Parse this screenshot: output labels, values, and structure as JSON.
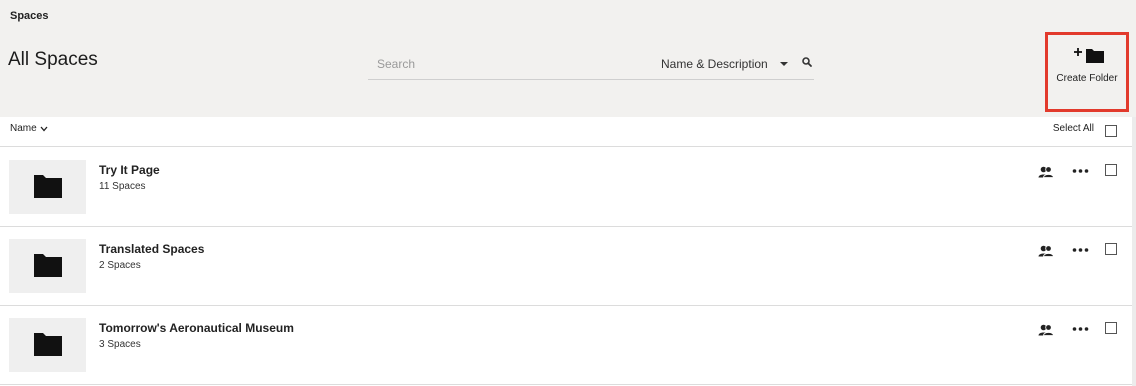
{
  "breadcrumb": "Spaces",
  "page_title": "All Spaces",
  "search": {
    "placeholder": "Search",
    "value": "",
    "scope": "Name & Description"
  },
  "create_folder": {
    "label": "Create Folder",
    "icon": "add-folder-icon"
  },
  "list_header": {
    "sort_label": "Name",
    "select_all_label": "Select All"
  },
  "rows": [
    {
      "title": "Try It Page",
      "subtitle": "11 Spaces"
    },
    {
      "title": "Translated Spaces",
      "subtitle": "2 Spaces"
    },
    {
      "title": "Tomorrow's Aeronautical Museum",
      "subtitle": "3 Spaces"
    }
  ],
  "colors": {
    "header_bg": "#f2f1ef",
    "highlight": "#e23a2c"
  }
}
